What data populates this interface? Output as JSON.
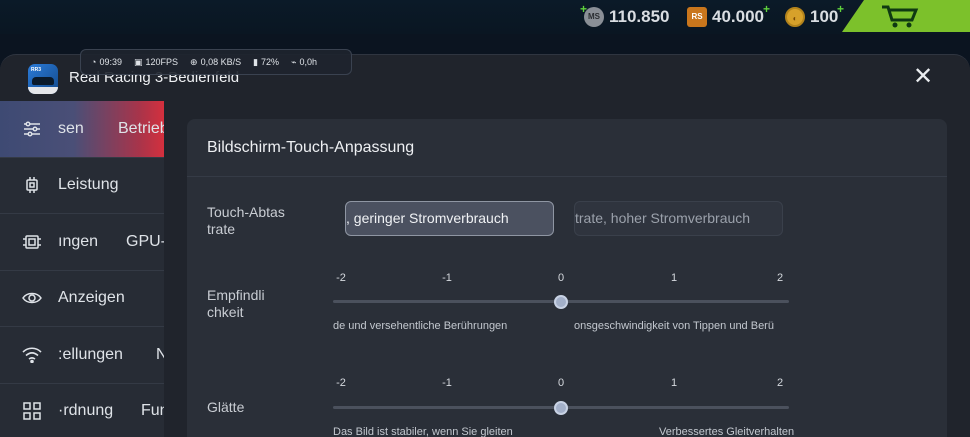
{
  "topbar": {
    "ms": {
      "icon": "MS",
      "value": "110.850"
    },
    "rs": {
      "icon": "RS",
      "value": "40.000"
    },
    "gold": {
      "value": "100"
    },
    "plus": "+",
    "cart_icon": "cart-icon"
  },
  "status": {
    "time": "09:39",
    "fps": "120FPS",
    "net": "0,08 KB/S",
    "battery": "72%",
    "power": "0,0h"
  },
  "panel": {
    "title": "Real Racing 3-Bedienfeld",
    "close_label": "✕",
    "app_icon_label": "RR3"
  },
  "sidebar": {
    "items": [
      {
        "label": "sen",
        "label2": "Betrieb",
        "icon": "sliders-icon"
      },
      {
        "label": "Leistung",
        "icon": "cpu-icon"
      },
      {
        "label": "ıngen",
        "label2": "GPU-",
        "icon": "gpu-chip-icon"
      },
      {
        "label": "Anzeigen",
        "icon": "eye-icon"
      },
      {
        "label": ":ellungen",
        "label2": "N",
        "icon": "wifi-icon"
      },
      {
        "label": "·rdnung",
        "label2": "Fun",
        "icon": "grid-icon"
      }
    ]
  },
  "card": {
    "title": "Bildschirm-Touch-Anpassung",
    "touch_rate": {
      "label": "Touch-Abtas trate",
      "option_selected": ", geringer Stromverbrauch",
      "option_other": "trate, hoher Stromverbrauch"
    },
    "sensitivity": {
      "label": "Empfindli chkeit",
      "ticks": [
        "-2",
        "-1",
        "0",
        "1",
        "2"
      ],
      "value": 0,
      "hint_left": "de und versehentliche  Berührungen",
      "hint_right": "onsgeschwindigkeit  von Tippen und Berü"
    },
    "smoothness": {
      "label": "Glätte",
      "ticks": [
        "-2",
        "-1",
        "0",
        "1",
        "2"
      ],
      "value": 0,
      "hint_left": "Das Bild ist stabiler, wenn Sie gleiten",
      "hint_right": "Verbessertes Gleitverhalten"
    }
  },
  "colors": {
    "accent_red": "#d4303e",
    "accent_blue": "#3e4a73",
    "cart_green": "#7cc12b"
  }
}
